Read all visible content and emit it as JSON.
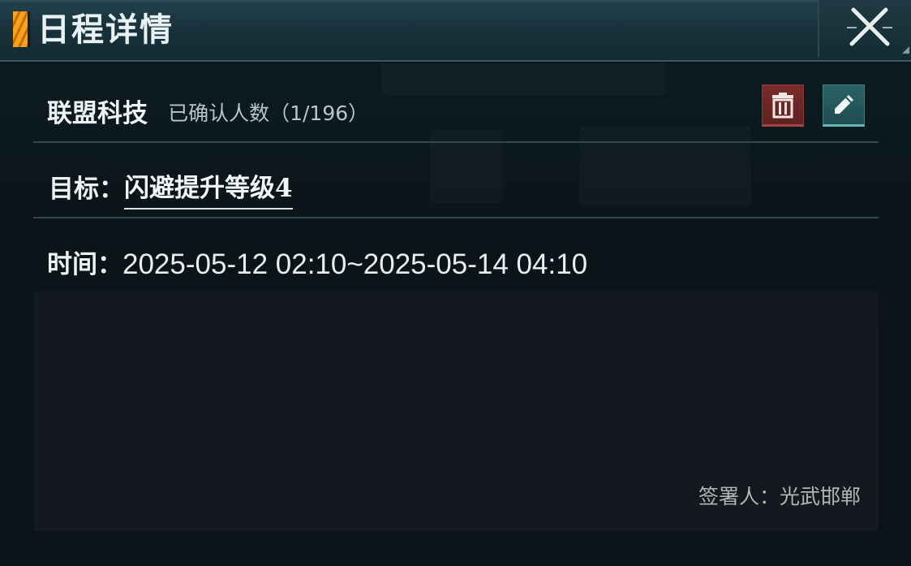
{
  "header": {
    "title": "日程详情",
    "close_icon": "close-x-icon"
  },
  "event": {
    "alliance_name": "联盟科技",
    "confirmed_text": "已确认人数（1/196）",
    "goal_label": "目标：",
    "goal_value": "闪避提升等级4",
    "time_label": "时间：",
    "time_value": "2025-05-12 02:10~2025-05-14 04:10",
    "signer_text": "签署人：光武邯郸"
  },
  "actions": {
    "delete_icon": "trash-icon",
    "edit_icon": "pencil-icon"
  },
  "colors": {
    "delete_button": "#6b2826",
    "edit_button": "#245659",
    "accent": "#f6a21a"
  }
}
